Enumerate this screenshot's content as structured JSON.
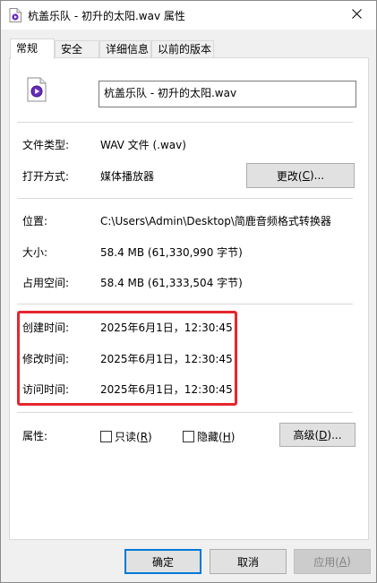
{
  "window": {
    "title": "杭盖乐队 - 初升的太阳.wav 属性"
  },
  "tabs": [
    {
      "label": "常规"
    },
    {
      "label": "安全"
    },
    {
      "label": "详细信息"
    },
    {
      "label": "以前的版本"
    }
  ],
  "general": {
    "file_name": "杭盖乐队 - 初升的太阳.wav",
    "type_label": "文件类型:",
    "type_value": "WAV 文件 (.wav)",
    "open_with_label": "打开方式:",
    "open_with_value": "媒体播放器",
    "change_button": {
      "prefix": "更改(",
      "key": "C",
      "suffix": ")..."
    },
    "location_label": "位置:",
    "location_value": "C:\\Users\\Admin\\Desktop\\简鹿音频格式转换器",
    "size_label": "大小:",
    "size_value": "58.4 MB (61,330,990 字节)",
    "size_on_disk_label": "占用空间:",
    "size_on_disk_value": "58.4 MB (61,333,504 字节)",
    "created_label": "创建时间:",
    "created_value": "2025年6月1日，12:30:45",
    "modified_label": "修改时间:",
    "modified_value": "2025年6月1日，12:30:45",
    "accessed_label": "访问时间:",
    "accessed_value": "2025年6月1日，12:30:45",
    "attributes_label": "属性:",
    "readonly": {
      "prefix": "只读(",
      "key": "R",
      "suffix": ")"
    },
    "hidden": {
      "prefix": "隐藏(",
      "key": "H",
      "suffix": ")"
    },
    "advanced_button": {
      "prefix": "高级(",
      "key": "D",
      "suffix": ")..."
    }
  },
  "footer": {
    "ok_label": "确定",
    "cancel_label": "取消",
    "apply_button": {
      "prefix": "应用(",
      "key": "A",
      "suffix": ")"
    }
  },
  "colors": {
    "highlight_border": "#e5262e",
    "default_button_border": "#0078d7"
  }
}
